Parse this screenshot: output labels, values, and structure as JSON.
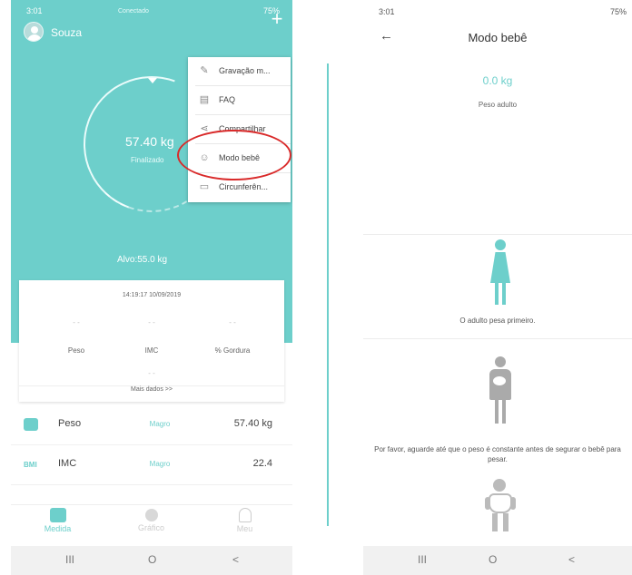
{
  "left": {
    "status": {
      "time": "3:01",
      "signal": "75%"
    },
    "header": {
      "user_name": "Souza",
      "connection": "Conectado"
    },
    "gauge": {
      "weight": "57.40 kg",
      "state": "Finalizado",
      "target": "Alvo:55.0 kg"
    },
    "menu": {
      "items": [
        {
          "icon": "edit-icon",
          "label": "Gravação m..."
        },
        {
          "icon": "book-icon",
          "label": "FAQ"
        },
        {
          "icon": "share-icon",
          "label": "Compartilhar"
        },
        {
          "icon": "baby-mode-icon",
          "label": "Modo bebê"
        },
        {
          "icon": "tape-icon",
          "label": "Circunferên..."
        }
      ],
      "highlighted": "Modo bebê",
      "highlight_color": "#d92a2a"
    },
    "card": {
      "datetime": "14:19:17 10/09/2019",
      "columns": [
        {
          "value": "- -",
          "label": "Peso"
        },
        {
          "value": "- -",
          "label": "IMC"
        },
        {
          "value": "- -",
          "label": "% Gordura"
        }
      ],
      "extra_value": "- -",
      "more": "Mais dados >>"
    },
    "rows": [
      {
        "icon": "scale-icon",
        "name": "Peso",
        "status": "Magro",
        "value": "57.40 kg"
      },
      {
        "icon": "bmi-icon",
        "name": "IMC",
        "status": "Magro",
        "value": "22.4"
      }
    ],
    "bmi_icon_text": "BMI",
    "nav": {
      "items": [
        {
          "label": "Medida",
          "active": true
        },
        {
          "label": "Gráfico",
          "active": false
        },
        {
          "label": "Meu",
          "active": false
        }
      ]
    },
    "accent": "#6dcfcb"
  },
  "right": {
    "status": {
      "time": "3:01",
      "signal": "75%"
    },
    "title": "Modo bebê",
    "weight": "0.0 kg",
    "weight_label": "Peso adulto",
    "steps": [
      {
        "text": "O adulto pesa primeiro."
      },
      {
        "text": "Por favor, aguarde até que o peso é constante antes de segurar o bebê para pesar."
      }
    ]
  },
  "system_nav": {
    "recent": "III",
    "home": "O",
    "back": "<"
  }
}
